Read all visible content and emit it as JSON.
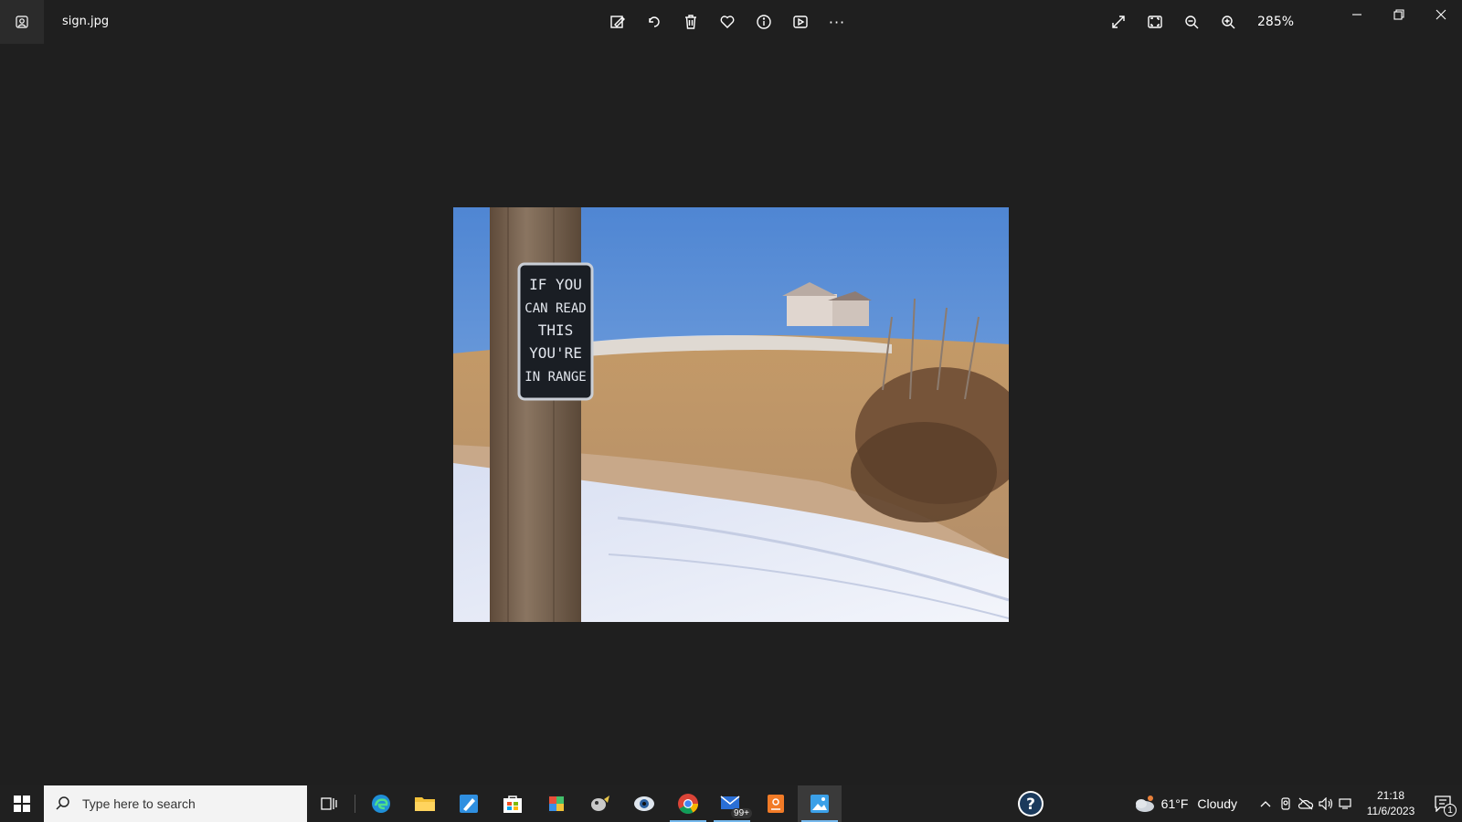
{
  "window": {
    "filename": "sign.jpg",
    "zoom": "285%"
  },
  "toolbar": {
    "items": [
      "edit-image-icon",
      "rotate-icon",
      "delete-icon",
      "favorite-icon",
      "info-icon",
      "slideshow-icon",
      "more-icon"
    ],
    "more_label": "···"
  },
  "view_controls": [
    "full-screen-icon",
    "fit-window-icon",
    "zoom-out-icon",
    "zoom-in-icon"
  ],
  "photo": {
    "sign_lines": [
      "IF YOU",
      "CAN READ",
      "THIS",
      "YOU'RE",
      "IN RANGE"
    ]
  },
  "taskbar": {
    "search_placeholder": "Type here to search",
    "mail_badge": "99+",
    "weather_temp": "61°F",
    "weather_condition": "Cloudy",
    "time": "21:18",
    "date": "11/6/2023",
    "notification_count": "1"
  },
  "colors": {
    "background": "#1f1f1f",
    "taskbar": "#202020",
    "accent": "#76b9ed"
  }
}
